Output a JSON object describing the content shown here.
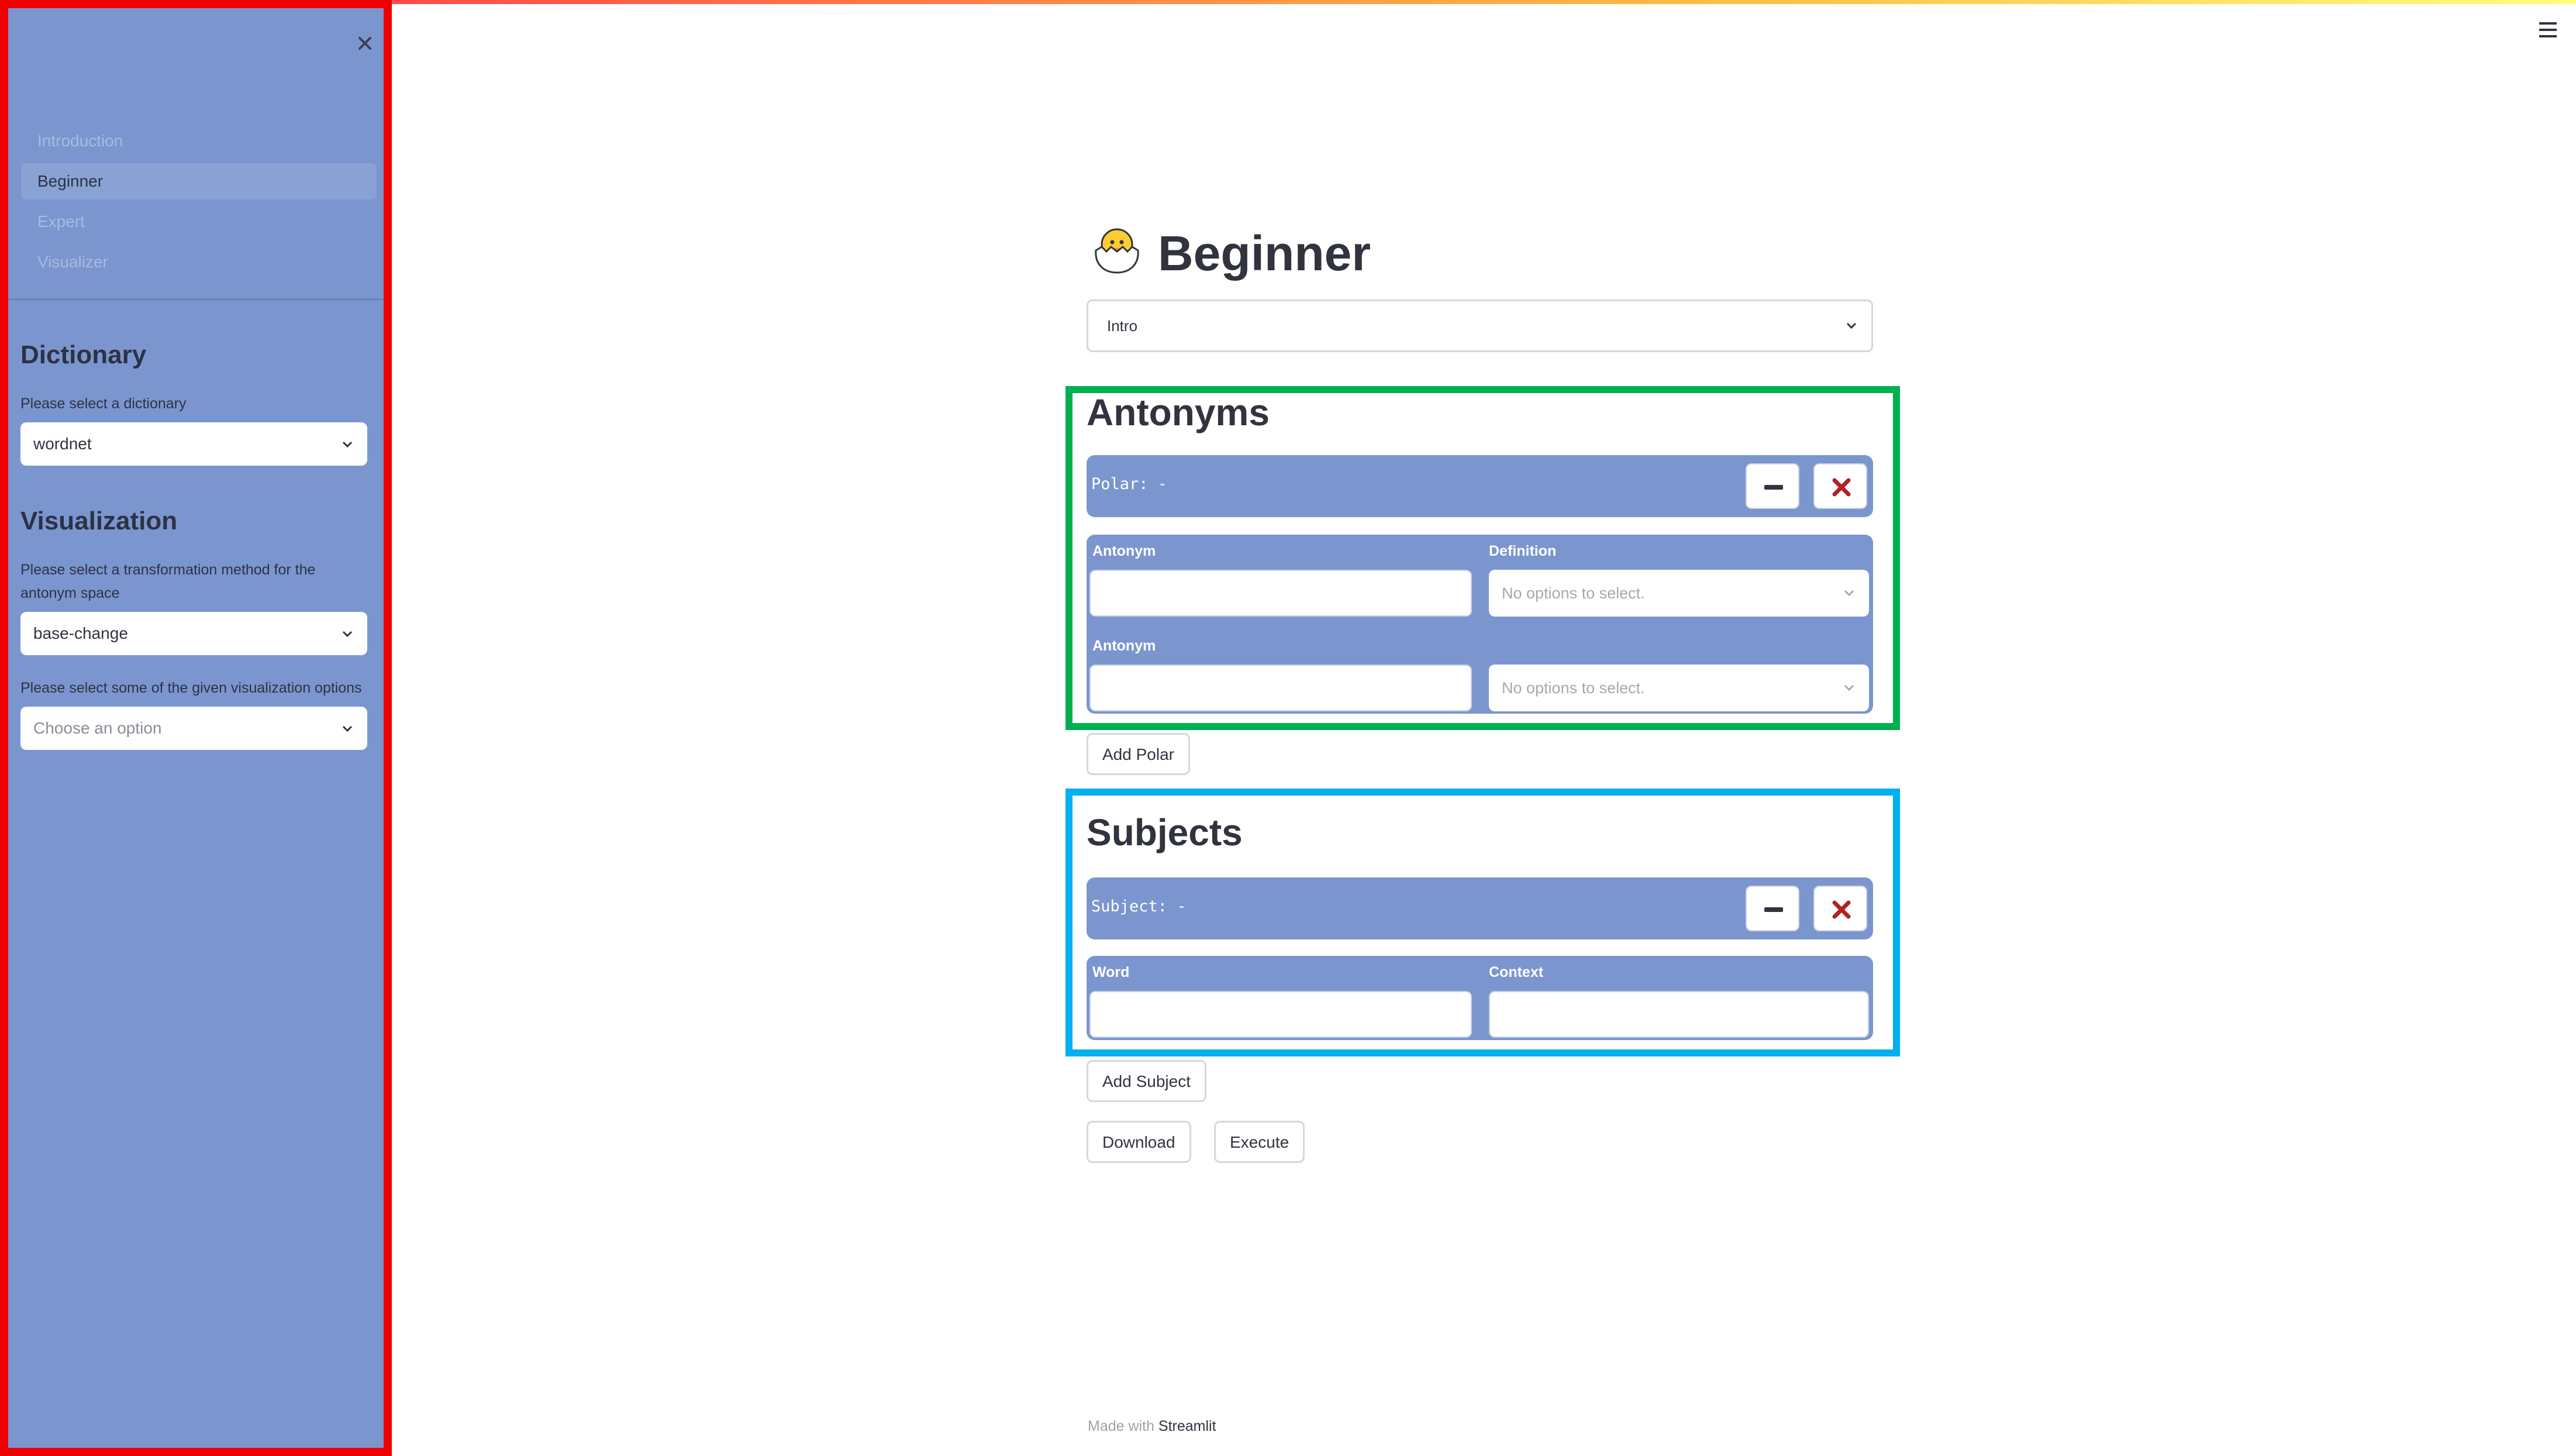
{
  "sidebar": {
    "nav": [
      {
        "label": "Introduction"
      },
      {
        "label": "Beginner",
        "active": true
      },
      {
        "label": "Expert"
      },
      {
        "label": "Visualizer"
      }
    ],
    "dictionary": {
      "heading": "Dictionary",
      "label": "Please select a dictionary",
      "value": "wordnet"
    },
    "visualization": {
      "heading": "Visualization",
      "method_label": "Please select a transformation method for the antonym space",
      "method_value": "base-change",
      "options_label": "Please select some of the given visualization options",
      "options_placeholder": "Choose an option"
    }
  },
  "page": {
    "title": "Beginner",
    "title_icon": "hatching-chick-icon",
    "section_select": "Intro"
  },
  "antonyms": {
    "heading": "Antonyms",
    "polar_label": "Polar:  -",
    "row1": {
      "label": "Antonym",
      "definition_label": "Definition",
      "definition_placeholder": "No options to select."
    },
    "row2": {
      "label": "Antonym",
      "definition_placeholder": "No options to select."
    },
    "add_button": "Add Polar"
  },
  "subjects": {
    "heading": "Subjects",
    "subject_label": "Subject:  -",
    "word_label": "Word",
    "context_label": "Context",
    "add_button": "Add Subject"
  },
  "actions": {
    "download": "Download",
    "execute": "Execute"
  },
  "footer": {
    "prefix": "Made with",
    "brand": "Streamlit"
  },
  "colors": {
    "sidebar_bg": "#7b96ce",
    "sidebar_frame": "#ee0000",
    "antonyms_frame": "#00b050",
    "subjects_frame": "#00b0f0",
    "remove_x": "#b22222"
  }
}
